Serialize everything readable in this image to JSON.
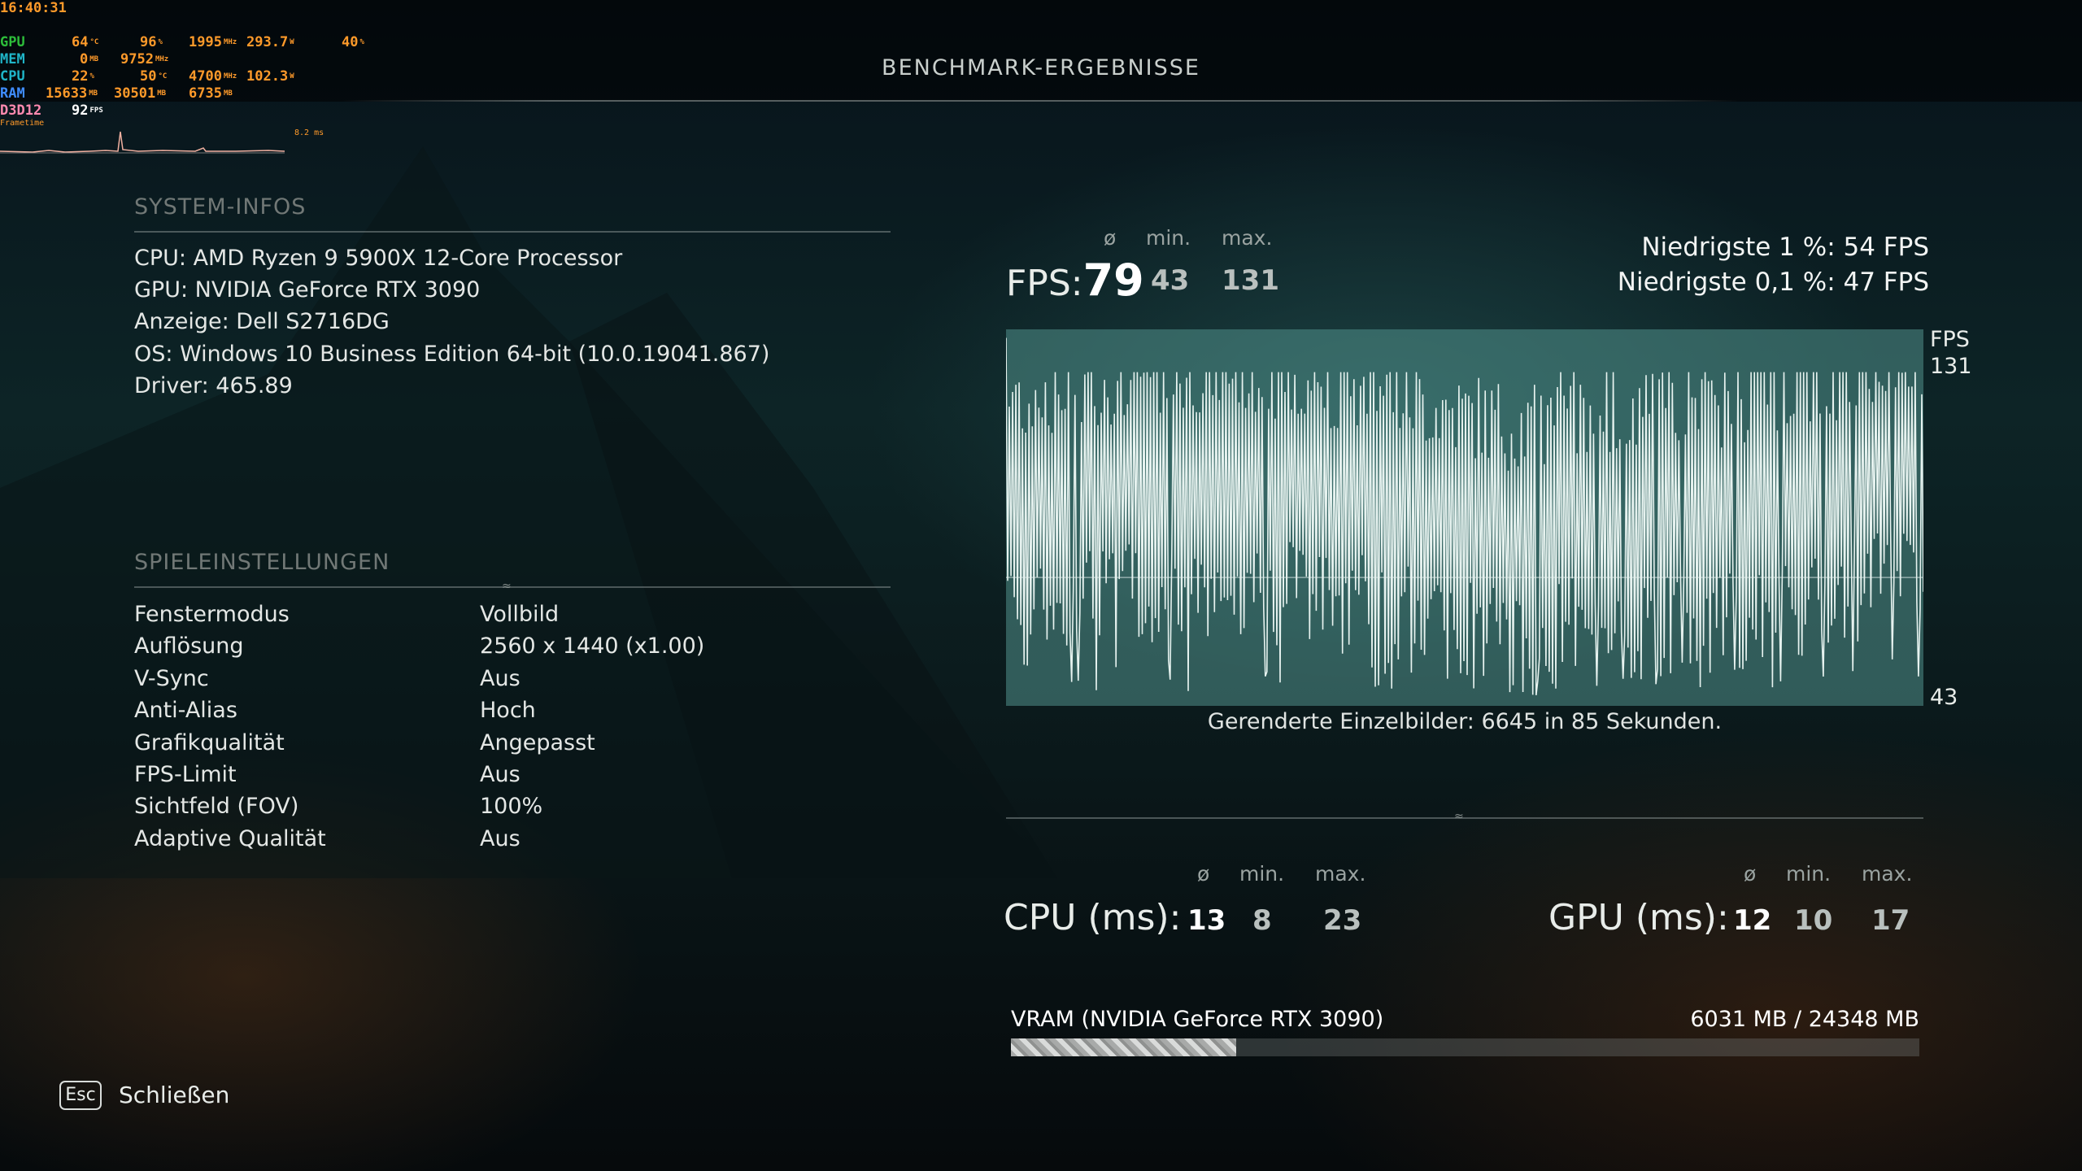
{
  "page": {
    "title": "BENCHMARK-ERGEBNISSE"
  },
  "overlay": {
    "time": "16:40:31",
    "rows": [
      {
        "label": "GPU",
        "v1": "64",
        "u1": "°C",
        "v2": "96",
        "u2": "%",
        "v3": "1995",
        "u3": "MHz",
        "v4": "293.7",
        "u4": "W",
        "v5": "40",
        "u5": "%"
      },
      {
        "label": "MEM",
        "v1": "0",
        "u1": "MB",
        "v2": "9752",
        "u2": "MHz"
      },
      {
        "label": "CPU",
        "v1": "22",
        "u1": "%",
        "v2": "50",
        "u2": "°C",
        "v3": "4700",
        "u3": "MHz",
        "v4": "102.3",
        "u4": "W"
      },
      {
        "label": "RAM",
        "v1": "15633",
        "u1": "MB",
        "v2": "30501",
        "u2": "MB",
        "v3": "6735",
        "u3": "MB"
      },
      {
        "label": "D3D12",
        "v1": "92",
        "u1": "FPS"
      }
    ],
    "frametime_label": "Frametime",
    "frametime_value": "8.2 ms"
  },
  "system": {
    "heading": "SYSTEM-INFOS",
    "lines": [
      "CPU: AMD Ryzen 9 5900X 12-Core Processor",
      "GPU: NVIDIA GeForce RTX 3090",
      "Anzeige: Dell S2716DG",
      "OS: Windows 10 Business Edition 64-bit (10.0.19041.867)",
      "Driver: 465.89"
    ]
  },
  "settings": {
    "heading": "SPIELEINSTELLUNGEN",
    "rows": [
      {
        "label": "Fenstermodus",
        "value": "Vollbild"
      },
      {
        "label": "Auflösung",
        "value": "2560 x 1440 (x1.00)"
      },
      {
        "label": "V-Sync",
        "value": "Aus"
      },
      {
        "label": "Anti-Alias",
        "value": "Hoch"
      },
      {
        "label": "Grafikqualität",
        "value": "Angepasst"
      },
      {
        "label": "FPS-Limit",
        "value": "Aus"
      },
      {
        "label": "Sichtfeld (FOV)",
        "value": "100%"
      },
      {
        "label": "Adaptive Qualität",
        "value": "Aus"
      }
    ]
  },
  "fps": {
    "label": "FPS:",
    "avg_symbol": "ø",
    "min_label": "min.",
    "max_label": "max.",
    "avg": "79",
    "min": "43",
    "max": "131",
    "low1": "Niedrigste 1 %: 54 FPS",
    "low01": "Niedrigste 0,1 %: 47 FPS"
  },
  "chart_data": {
    "type": "line",
    "title": "",
    "ylabel": "FPS",
    "ylim": [
      43,
      131
    ],
    "y_tick_labels": [
      "131",
      "43"
    ],
    "frames": 6645,
    "duration_s": 85,
    "approx_series_summary": {
      "avg": 79,
      "min": 43,
      "max": 131
    },
    "caption": "Gerenderte Einzelbilder: 6645 in 85 Sekunden."
  },
  "cpu": {
    "label": "CPU (ms):",
    "avg_symbol": "ø",
    "min_label": "min.",
    "max_label": "max.",
    "avg": "13",
    "min": "8",
    "max": "23"
  },
  "gpu": {
    "label": "GPU (ms):",
    "avg_symbol": "ø",
    "min_label": "min.",
    "max_label": "max.",
    "avg": "12",
    "min": "10",
    "max": "17"
  },
  "vram": {
    "label": "VRAM (NVIDIA GeForce RTX 3090)",
    "usage": "6031 MB / 24348 MB",
    "fraction": 0.2477
  },
  "footer": {
    "esc_key": "Esc",
    "close_label": "Schließen"
  }
}
